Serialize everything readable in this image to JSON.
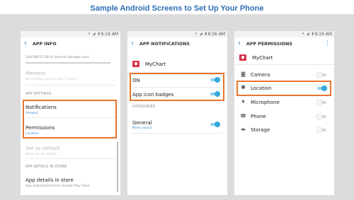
{
  "header": {
    "title": "Sample Android Screens to Set Up Your Phone"
  },
  "colors": {
    "accent": "#2a7fc1",
    "highlight": "#e8762c",
    "toggle_on": "#34a9dd"
  },
  "phone1": {
    "status_time": "9:19 AM",
    "title": "APP INFO",
    "storage_info": "148 MB/32 GB of internal storage used",
    "memory_label": "Memory",
    "memory_info": "No memory used in last 3 hours",
    "section_settings": "APP SETTINGS",
    "notifications_label": "Notifications",
    "notifications_value": "Allowed",
    "permissions_label": "Permissions",
    "permissions_value": "Location",
    "default_label": "Set as default",
    "default_value": "None set as default",
    "section_store": "APP DETAILS IN STORE",
    "store_label": "App details in store",
    "store_value": "App downloaded from Google Play Store"
  },
  "phone2": {
    "status_time": "9:36 AM",
    "title": "APP NOTIFICATIONS",
    "app_name": "MyChart",
    "on_label": "ON",
    "on_toggle": true,
    "badges_label": "App icon badges",
    "badges_toggle": true,
    "section_categories": "CATEGORIES",
    "general_label": "General",
    "general_value": "Make sound",
    "general_toggle": true
  },
  "phone3": {
    "status_time": "9:19 AM",
    "title": "APP PERMISSIONS",
    "menu_icon": "more-vert-icon",
    "app_name": "MyChart",
    "permissions": [
      {
        "label": "Camera",
        "icon": "camera-icon",
        "enabled": false
      },
      {
        "label": "Location",
        "icon": "location-pin-icon",
        "enabled": true
      },
      {
        "label": "Microphone",
        "icon": "microphone-icon",
        "enabled": false
      },
      {
        "label": "Phone",
        "icon": "phone-icon",
        "enabled": false
      },
      {
        "label": "Storage",
        "icon": "folder-icon",
        "enabled": false
      }
    ]
  }
}
